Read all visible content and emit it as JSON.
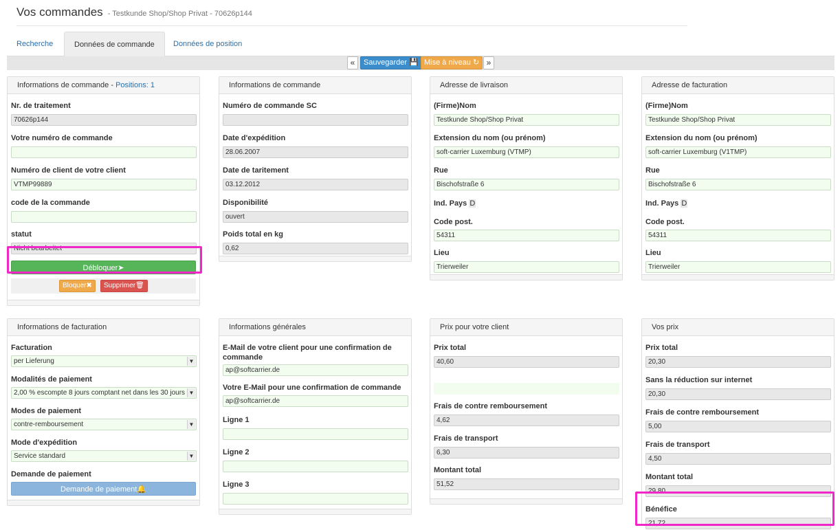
{
  "header": {
    "title": "Vos commandes",
    "subtitle": "- Testkunde Shop/Shop Privat - 70626p144"
  },
  "tabs": [
    {
      "label": "Recherche"
    },
    {
      "label": "Données de commande"
    },
    {
      "label": "Données de position"
    }
  ],
  "toolbar": {
    "prev": "«",
    "save": "Sauvegarder",
    "update": "Mise à niveau",
    "next": "»"
  },
  "order_info": {
    "title": "Informations de commande - ",
    "positions_link": "Positions: 1",
    "processing_no_label": "Nr. de traitement",
    "processing_no": "70626p144",
    "your_order_no_label": "Votre numéro de commande",
    "your_order_no": "",
    "customer_no_label": "Numéro de client de votre client",
    "customer_no": "VTMP99889",
    "order_code_label": "code de la commande",
    "order_code": "",
    "status_label": "statut",
    "status": "Nicht bearbeitet",
    "unlock_button": "Débloquer",
    "lock_button": "Bloquer",
    "delete_button": "Supprimer"
  },
  "order_info2": {
    "title": "Informations de commande",
    "sc_no_label": "Numéro de commande SC",
    "sc_no": "",
    "ship_date_label": "Date d'expédition",
    "ship_date": "28.06.2007",
    "proc_date_label": "Date de taritement",
    "proc_date": "03.12.2012",
    "availability_label": "Disponibilité",
    "availability": "ouvert",
    "weight_label": "Poids total en kg",
    "weight": "0,62"
  },
  "delivery": {
    "title": "Adresse de livraison",
    "name_label": "(Firme)Nom",
    "name": "Testkunde Shop/Shop Privat",
    "ext_label": "Extension du nom (ou prénom)",
    "ext": "soft-carrier Luxemburg (VTMP)",
    "street_label": "Rue",
    "street": "Bischofstraße 6",
    "country_label": "Ind. Pays",
    "country": "D",
    "zip_label": "Code post.",
    "zip": "54311",
    "city_label": "Lieu",
    "city": "Trierweiler"
  },
  "billing_address": {
    "title": "Adresse de facturation",
    "name_label": "(Firme)Nom",
    "name": "Testkunde Shop/Shop Privat",
    "ext_label": "Extension du nom (ou prénom)",
    "ext": "soft-carrier Luxemburg (V1TMP)",
    "street_label": "Rue",
    "street": "Bischofstraße 6",
    "country_label": "Ind. Pays",
    "country": "D",
    "zip_label": "Code post.",
    "zip": "54311",
    "city_label": "Lieu",
    "city": "Trierweiler"
  },
  "billing_info": {
    "title": "Informations de facturation",
    "invoicing_label": "Facturation",
    "invoicing": "per Lieferung",
    "payment_terms_label": "Modalités de paiement",
    "payment_terms": "2,00 % escompte 8 jours comptant net dans les 30 jours",
    "payment_modes_label": "Modes de paiement",
    "payment_mode": "contre-remboursement",
    "shipping_label": "Mode d'expédition",
    "shipping": "Service standard",
    "payment_request_label": "Demande de paiement",
    "payment_request_button": "Demande de paiement"
  },
  "general_info": {
    "title": "Informations générales",
    "client_email_label": "E-Mail de votre client pour une confirmation de commande",
    "client_email": "ap@softcarrier.de",
    "your_email_label": "Votre E-Mail pour une confirmation de commande",
    "your_email": "ap@softcarrier.de",
    "line1_label": "Ligne 1",
    "line1": "",
    "line2_label": "Ligne 2",
    "line2": "",
    "line3_label": "Ligne 3",
    "line3": ""
  },
  "client_price": {
    "title": "Prix pour votre client",
    "total_label": "Prix total",
    "total": "40,60",
    "cod_label": "Frais de contre remboursement",
    "cod": "4,62",
    "transport_label": "Frais de transport",
    "transport": "6,30",
    "amount_label": "Montant total",
    "amount": "51,52"
  },
  "your_price": {
    "title": "Vos prix",
    "total_label": "Prix total",
    "total": "20,30",
    "no_discount_label": "Sans la réduction sur internet",
    "no_discount": "20,30",
    "cod_label": "Frais de contre remboursement",
    "cod": "5,00",
    "transport_label": "Frais de transport",
    "transport": "4,50",
    "amount_label": "Montant total",
    "amount": "29,80",
    "profit_label": "Bénéfice",
    "profit": "21,72"
  },
  "colors": {
    "highlight": "#f026c6",
    "green": "#55b558",
    "blue": "#3b8dcc",
    "orange": "#efa84a",
    "red": "#d9534f"
  }
}
